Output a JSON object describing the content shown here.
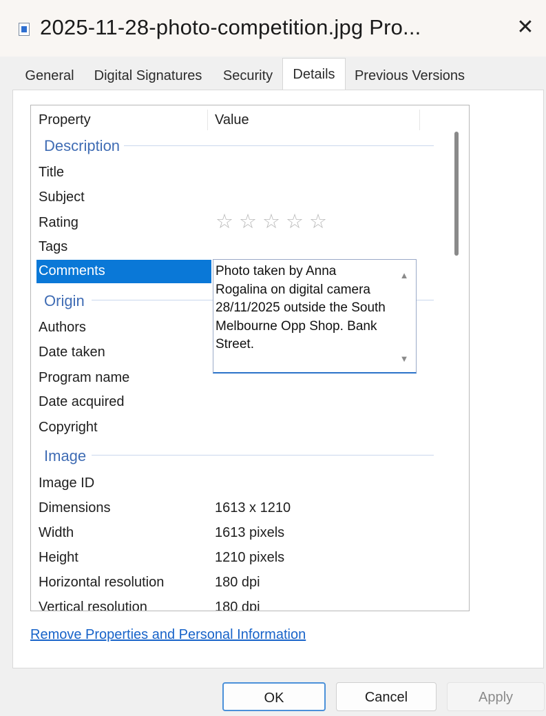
{
  "window": {
    "title": "2025-11-28-photo-competition.jpg Pro...",
    "close_glyph": "✕"
  },
  "tabs": [
    {
      "label": "General"
    },
    {
      "label": "Digital Signatures"
    },
    {
      "label": "Security"
    },
    {
      "label": "Details",
      "active": true
    },
    {
      "label": "Previous Versions"
    }
  ],
  "list": {
    "columns": {
      "property": "Property",
      "value": "Value"
    },
    "groups": {
      "description": "Description",
      "origin": "Origin",
      "image": "Image"
    },
    "rows": {
      "title": {
        "name": "Title",
        "value": ""
      },
      "subject": {
        "name": "Subject",
        "value": ""
      },
      "rating": {
        "name": "Rating",
        "stars": 0,
        "max_stars": 5
      },
      "tags": {
        "name": "Tags",
        "value": ""
      },
      "comments": {
        "name": "Comments",
        "value": "Photo taken by Anna Rogalina on digital camera 28/11/2025 outside the South Melbourne Opp Shop. Bank Street."
      },
      "authors": {
        "name": "Authors",
        "value": ""
      },
      "date_taken": {
        "name": "Date taken",
        "value": ""
      },
      "program_name": {
        "name": "Program name",
        "value": ""
      },
      "date_acquired": {
        "name": "Date acquired",
        "value": ""
      },
      "copyright": {
        "name": "Copyright",
        "value": ""
      },
      "image_id": {
        "name": "Image ID",
        "value": ""
      },
      "dimensions": {
        "name": "Dimensions",
        "value": "1613 x 1210"
      },
      "width": {
        "name": "Width",
        "value": "1613 pixels"
      },
      "height": {
        "name": "Height",
        "value": "1210 pixels"
      },
      "horizontal_resolution": {
        "name": "Horizontal resolution",
        "value": "180 dpi"
      },
      "vertical_resolution": {
        "name": "Vertical resolution",
        "value": "180 dpi"
      }
    }
  },
  "links": {
    "remove_properties": "Remove Properties and Personal Information"
  },
  "buttons": {
    "ok": "OK",
    "cancel": "Cancel",
    "apply": "Apply"
  },
  "icons": {
    "star": "☆",
    "scroll_up": "▲",
    "scroll_down": "▼"
  },
  "colors": {
    "accent": "#0a78d7",
    "group_label": "#3f6cb4",
    "link": "#1763c9"
  }
}
